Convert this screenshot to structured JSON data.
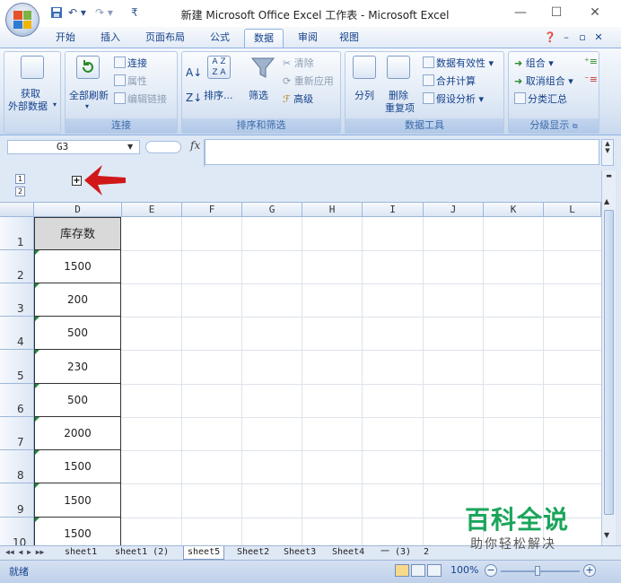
{
  "window": {
    "title": "新建 Microsoft Office Excel 工作表 - Microsoft Excel",
    "minimize": "—",
    "maximize": "☐",
    "close": "✕"
  },
  "tabs": [
    "开始",
    "插入",
    "页面布局",
    "公式",
    "数据",
    "审阅",
    "视图"
  ],
  "active_tab": "数据",
  "ribbon": {
    "get_external": {
      "line1": "获取",
      "line2": "外部数据"
    },
    "connections": {
      "refresh_all": "全部刷新",
      "connections": "连接",
      "properties": "属性",
      "edit_links": "编辑链接",
      "label": "连接"
    },
    "sort_filter": {
      "sort": "排序...",
      "filter": "筛选",
      "clear": "清除",
      "reapply": "重新应用",
      "advanced": "高级",
      "label": "排序和筛选"
    },
    "data_tools": {
      "text_to_columns": "分列",
      "remove_dup_1": "删除",
      "remove_dup_2": "重复项",
      "validation": "数据有效性",
      "consolidate": "合并计算",
      "what_if": "假设分析",
      "label": "数据工具"
    },
    "outline": {
      "group": "组合",
      "ungroup": "取消组合",
      "subtotal": "分类汇总",
      "label": "分级显示"
    }
  },
  "formula_bar": {
    "name_box": "G3",
    "fx": "fx",
    "value": ""
  },
  "outline_levels": [
    "1",
    "2"
  ],
  "expand_symbol": "+",
  "columns": [
    "D",
    "E",
    "F",
    "G",
    "H",
    "I",
    "J",
    "K",
    "L"
  ],
  "rows": [
    "1",
    "2",
    "3",
    "4",
    "5",
    "6",
    "7",
    "8",
    "9",
    "10"
  ],
  "column_d": [
    "库存数",
    "1500",
    "200",
    "500",
    "230",
    "500",
    "2000",
    "1500",
    "1500",
    "1500"
  ],
  "sheet_tabs": [
    "sheet1",
    "sheet1 (2)",
    "sheet5",
    "Sheet2",
    "Sheet3",
    "Sheet4",
    "一 (3)",
    "2"
  ],
  "active_sheet": "sheet5",
  "status": {
    "ready": "就绪",
    "zoom": "100%"
  },
  "watermark": {
    "title": "百科全说",
    "subtitle": "助你轻松解决"
  },
  "colors": {
    "accent": "#15428b",
    "arrow": "#d01818",
    "watermark": "#1aa55a"
  }
}
